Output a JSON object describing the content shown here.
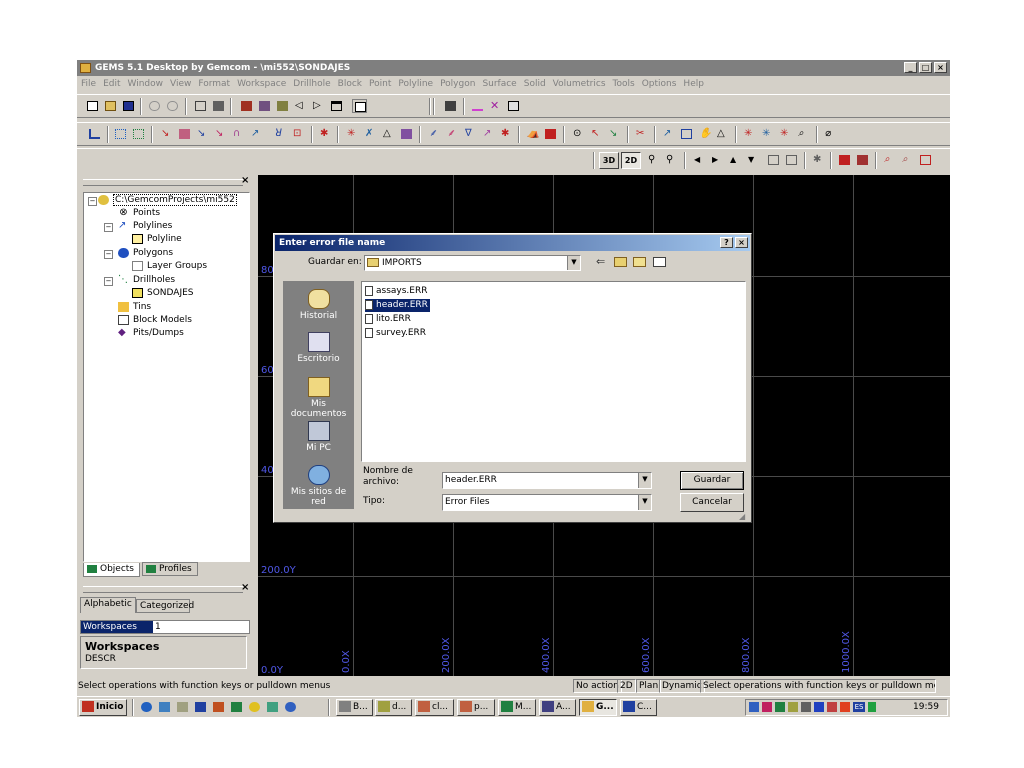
{
  "window": {
    "title": "GEMS 5.1 Desktop by Gemcom - \\mi552\\SONDAJES",
    "controls": [
      "_",
      "□",
      "×"
    ]
  },
  "menu": [
    "File",
    "Edit",
    "Window",
    "View",
    "Format",
    "Workspace",
    "Drillhole",
    "Block",
    "Point",
    "Polyline",
    "Polygon",
    "Surface",
    "Solid",
    "Volumetrics",
    "Tools",
    "Options",
    "Help"
  ],
  "toolbar": {
    "view_3d": "3D",
    "view_2d": "2D"
  },
  "tree": {
    "root": "C:\\GemcomProjects\\mi552",
    "items": [
      "Points",
      "Polylines",
      "Polyline",
      "Polygons",
      "Layer Groups",
      "Drillholes",
      "SONDAJES",
      "Tins",
      "Block Models",
      "Pits/Dumps"
    ]
  },
  "panel_tabs": [
    "Objects",
    "Profiles"
  ],
  "props": {
    "tabs": [
      "Alphabetic",
      "Categorized"
    ],
    "row_label": "Workspaces",
    "row_value": "1",
    "desc_title": "Workspaces",
    "desc_text": "DESCR"
  },
  "graph": {
    "y_labels": [
      "80",
      "60",
      "40",
      "200.0Y",
      "0.0Y"
    ],
    "x_labels": [
      "0.0X",
      "200.0X",
      "400.0X",
      "600.0X",
      "800.0X",
      "1000.0X"
    ]
  },
  "dialog": {
    "title": "Enter error file name",
    "help_btn": "?",
    "close_btn": "×",
    "save_in_label": "Guardar en:",
    "save_in_value": "IMPORTS",
    "places": [
      "Historial",
      "Escritorio",
      "Mis documentos",
      "Mi PC",
      "Mis sitios de red"
    ],
    "files": [
      "assays.ERR",
      "header.ERR",
      "lito.ERR",
      "survey.ERR"
    ],
    "filename_label": "Nombre de archivo:",
    "filename_value": "header.ERR",
    "type_label": "Tipo:",
    "type_value": "Error Files",
    "save_btn": "Guardar",
    "cancel_btn": "Cancelar"
  },
  "status": {
    "left": "Select operations with function keys or pulldown menus",
    "no_action": "No action",
    "mode_2d": "2D",
    "plan": "Plan",
    "dynamic": "Dynamic",
    "right": "Select operations with function keys or pulldown menus"
  },
  "taskbar": {
    "start": "Inicio",
    "tasks": [
      "B...",
      "d...",
      "cl...",
      "p...",
      "M...",
      "A...",
      "G...",
      "C..."
    ],
    "clock": "19:59",
    "lang": "ES"
  },
  "colors": {
    "title_active": "#0a246a",
    "title_inactive": "#7f7f7f",
    "selection": "#0a246a",
    "axis_label": "#5058e8"
  }
}
